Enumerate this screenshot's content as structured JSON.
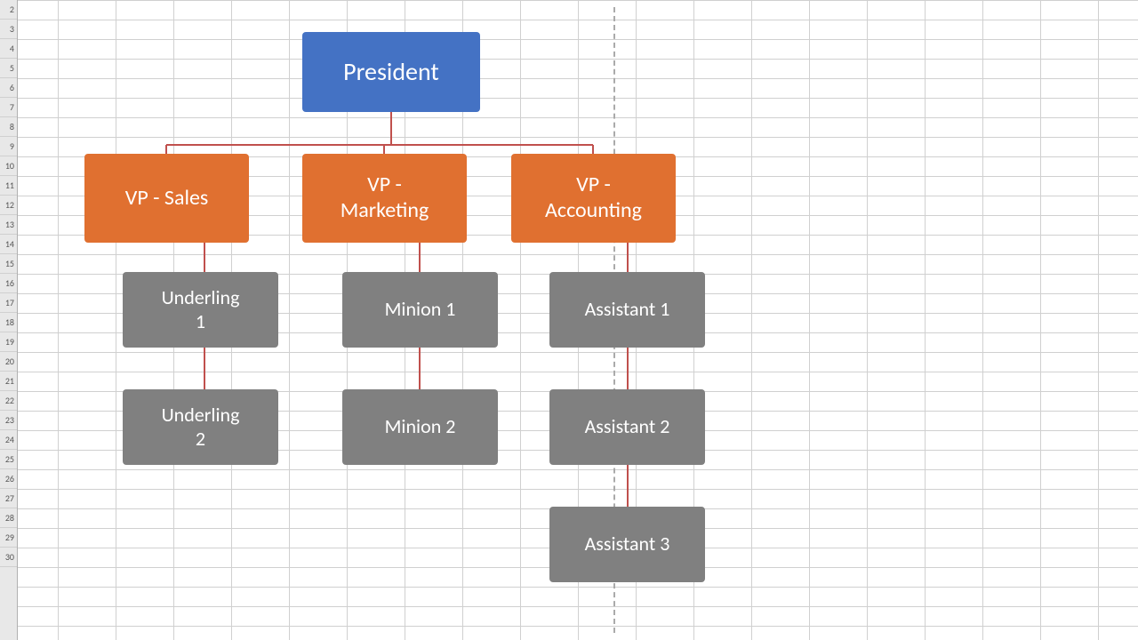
{
  "chart": {
    "president": "President",
    "vp_sales": "VP - Sales",
    "vp_marketing": "VP -\nMarketing",
    "vp_accounting": "VP -\nAccounting",
    "underling1": "Underling\n1",
    "underling2": "Underling\n2",
    "minion1": "Minion 1",
    "minion2": "Minion 2",
    "assistant1": "Assistant 1",
    "assistant2": "Assistant 2",
    "assistant3": "Assistant 3"
  },
  "rows": [
    "2",
    "3",
    "4",
    "5",
    "6",
    "7",
    "8",
    "9",
    "10",
    "11",
    "12",
    "13",
    "14",
    "15",
    "16",
    "17",
    "18",
    "19",
    "20",
    "21",
    "22",
    "23",
    "24",
    "25",
    "26",
    "27",
    "28",
    "29",
    "30"
  ],
  "colors": {
    "president": "#4472c4",
    "vp": "#e07030",
    "sub": "#888888",
    "line": "#c0504d",
    "bg": "#ffffff",
    "grid": "#d0d0d0"
  }
}
